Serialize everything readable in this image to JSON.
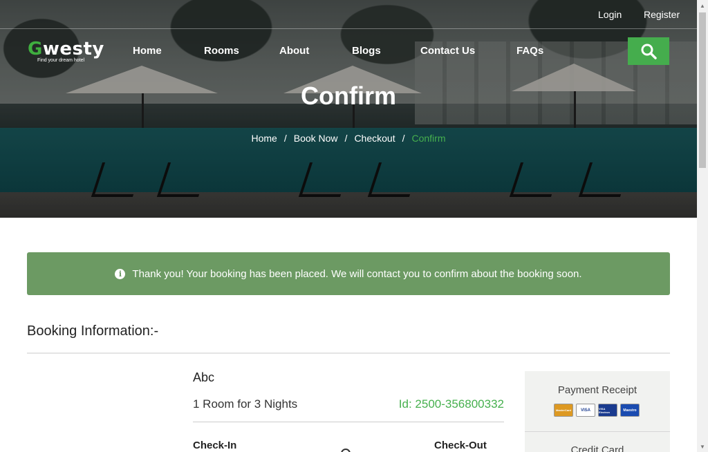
{
  "topbar": {
    "login": "Login",
    "register": "Register"
  },
  "logo": {
    "text_first": "G",
    "text_rest": "westy",
    "tagline": "Find your dream hotel"
  },
  "nav": {
    "items": [
      "Home",
      "Rooms",
      "About",
      "Blogs",
      "Contact Us",
      "FAQs"
    ]
  },
  "search": {
    "icon": "search-icon",
    "color": "#45ad4d"
  },
  "hero": {
    "title": "Confirm",
    "breadcrumb": [
      "Home",
      "Book Now",
      "Checkout",
      "Confirm"
    ]
  },
  "alert": {
    "icon": "info-icon",
    "message": "Thank you! Your booking has been placed. We will contact you to confirm about the booking soon.",
    "color": "#6c9a63"
  },
  "booking": {
    "section_title": "Booking Information:-",
    "room_name": "Abc",
    "room_summary": "1 Room for 3 Nights",
    "booking_id": "Id: 2500-356800332",
    "check_in_label": "Check-In",
    "check_out_label": "Check-Out"
  },
  "receipt": {
    "title": "Payment Receipt",
    "cards": [
      "MasterCard",
      "VISA",
      "VISA Electron",
      "Maestro"
    ],
    "method": "Credit Card"
  },
  "accent_color": "#46b04e"
}
